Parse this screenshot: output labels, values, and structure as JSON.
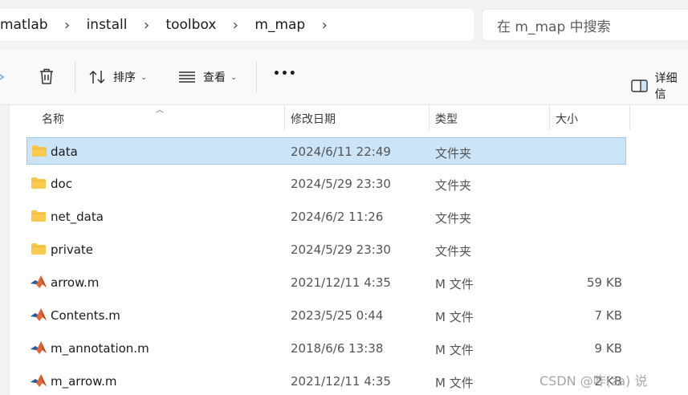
{
  "breadcrumb": {
    "items": [
      "matlab",
      "install",
      "toolbox",
      "m_map"
    ],
    "separator": "›"
  },
  "search": {
    "placeholder": "在 m_map 中搜索"
  },
  "toolbar": {
    "sort_label": "排序",
    "view_label": "查看",
    "more_label": "•••",
    "details_label": "详细信"
  },
  "columns": {
    "name": "名称",
    "modified": "修改日期",
    "type": "类型",
    "size": "大小"
  },
  "files": [
    {
      "name": "data",
      "modified": "2024/6/11 22:49",
      "type": "文件夹",
      "size": "",
      "kind": "folder",
      "selected": true
    },
    {
      "name": "doc",
      "modified": "2024/5/29 23:30",
      "type": "文件夹",
      "size": "",
      "kind": "folder",
      "selected": false
    },
    {
      "name": "net_data",
      "modified": "2024/6/2 11:26",
      "type": "文件夹",
      "size": "",
      "kind": "folder",
      "selected": false
    },
    {
      "name": "private",
      "modified": "2024/5/29 23:30",
      "type": "文件夹",
      "size": "",
      "kind": "folder",
      "selected": false
    },
    {
      "name": "arrow.m",
      "modified": "2021/12/11 4:35",
      "type": "M 文件",
      "size": "59 KB",
      "kind": "mfile",
      "selected": false
    },
    {
      "name": "Contents.m",
      "modified": "2023/5/25 0:44",
      "type": "M 文件",
      "size": "7 KB",
      "kind": "mfile",
      "selected": false
    },
    {
      "name": "m_annotation.m",
      "modified": "2018/6/6 13:38",
      "type": "M 文件",
      "size": "9 KB",
      "kind": "mfile",
      "selected": false
    },
    {
      "name": "m_arrow.m",
      "modified": "2021/12/11 4:35",
      "type": "M 文件",
      "size": "2 KB",
      "kind": "mfile",
      "selected": false
    }
  ],
  "icons": {
    "folder": "folder-icon",
    "mfile": "matlab-file-icon",
    "delete": "trash-icon",
    "sort": "sort-icon",
    "view": "view-icon",
    "details": "details-pane-icon"
  },
  "colors": {
    "selection_bg": "#cce4f7",
    "selection_border": "#99c9ef",
    "folder_yellow": "#f8c94a",
    "matlab_orange": "#e16737",
    "matlab_blue": "#1f5fa8"
  },
  "watermark": "CSDN @咋(za) 说"
}
